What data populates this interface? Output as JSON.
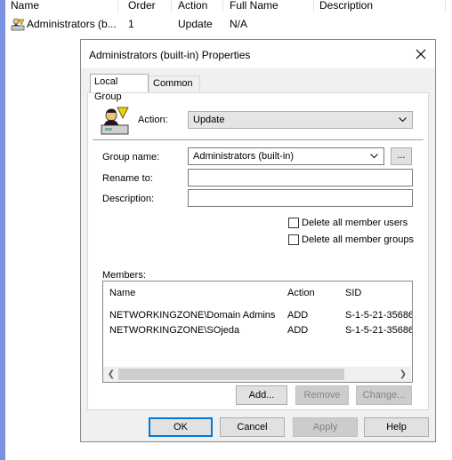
{
  "list": {
    "columns": [
      "Name",
      "Order",
      "Action",
      "Full Name",
      "Description"
    ],
    "row": {
      "name": "Administrators (b...",
      "order": "1",
      "action": "Update",
      "full_name": "N/A",
      "description": ""
    }
  },
  "dialog": {
    "title": "Administrators (built-in) Properties",
    "tabs": [
      {
        "label": "Local Group"
      },
      {
        "label": "Common"
      }
    ],
    "action_label": "Action:",
    "action_value": "Update",
    "group_name_label": "Group name:",
    "group_name_value": "Administrators (built-in)",
    "browse_label": "...",
    "rename_label": "Rename to:",
    "rename_value": "",
    "description_label": "Description:",
    "description_value": "",
    "delete_users_label": "Delete all member users",
    "delete_users_checked": false,
    "delete_groups_label": "Delete all member groups",
    "delete_groups_checked": false,
    "members_label": "Members:",
    "members_columns": [
      "Name",
      "Action",
      "SID"
    ],
    "members": [
      {
        "name": "NETWORKINGZONE\\Domain Admins",
        "action": "ADD",
        "sid": "S-1-5-21-35686"
      },
      {
        "name": "NETWORKINGZONE\\SOjeda",
        "action": "ADD",
        "sid": "S-1-5-21-35686"
      }
    ],
    "add_label": "Add...",
    "remove_label": "Remove",
    "change_label": "Change...",
    "ok_label": "OK",
    "cancel_label": "Cancel",
    "apply_label": "Apply",
    "help_label": "Help"
  }
}
